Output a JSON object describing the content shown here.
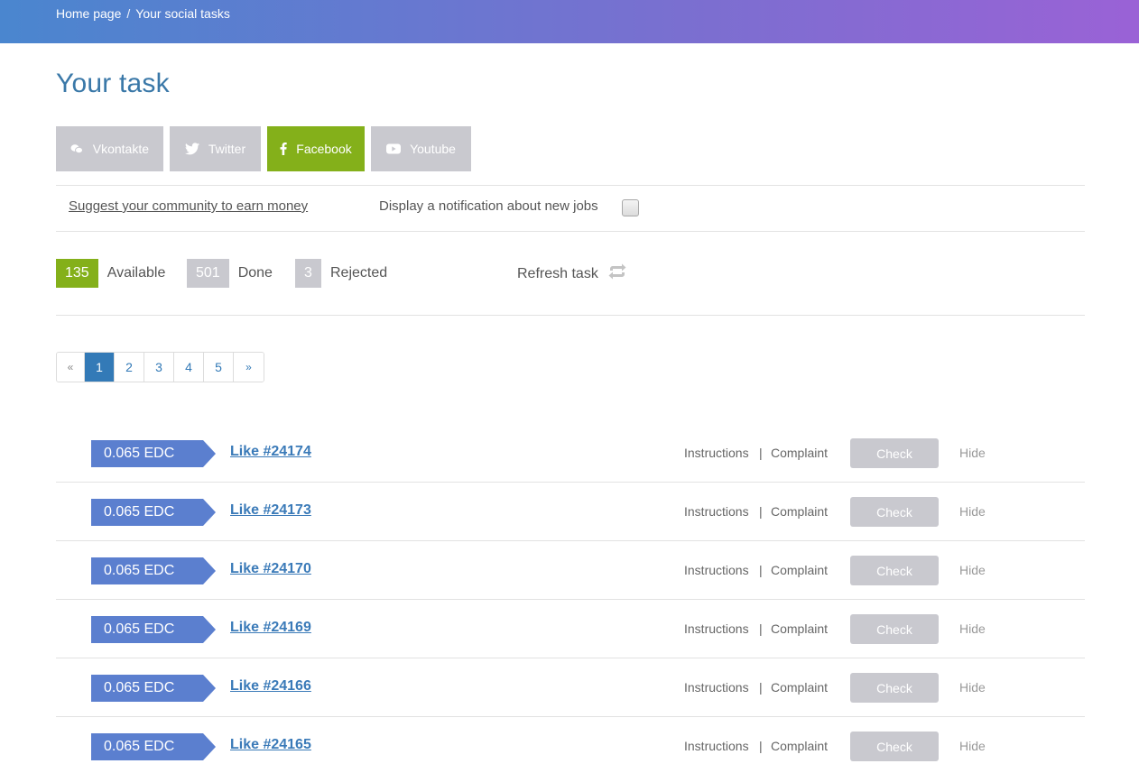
{
  "breadcrumb": {
    "home": "Home page",
    "separator": "/",
    "current": "Your social tasks"
  },
  "page_title": "Your task",
  "tabs": [
    {
      "label": "Vkontakte",
      "icon": "vk-icon",
      "active": false
    },
    {
      "label": "Twitter",
      "icon": "twitter-icon",
      "active": false
    },
    {
      "label": "Facebook",
      "icon": "facebook-icon",
      "active": true
    },
    {
      "label": "Youtube",
      "icon": "youtube-icon",
      "active": false
    }
  ],
  "options": {
    "suggest_link": "Suggest your community to earn money",
    "notify_label": "Display a notification about new jobs",
    "notify_checked": false
  },
  "stats": {
    "available": {
      "count": "135",
      "label": "Available"
    },
    "done": {
      "count": "501",
      "label": "Done"
    },
    "rejected": {
      "count": "3",
      "label": "Rejected"
    },
    "refresh_label": "Refresh task"
  },
  "pagination": {
    "prev": "«",
    "pages": [
      "1",
      "2",
      "3",
      "4",
      "5"
    ],
    "next": "»",
    "current": "1"
  },
  "task_actions": {
    "instructions": "Instructions",
    "separator": "|",
    "complaint": "Complaint",
    "check": "Check",
    "hide": "Hide"
  },
  "tasks": [
    {
      "price": "0.065 EDC",
      "title": "Like #24174"
    },
    {
      "price": "0.065 EDC",
      "title": "Like #24173"
    },
    {
      "price": "0.065 EDC",
      "title": "Like #24170"
    },
    {
      "price": "0.065 EDC",
      "title": "Like #24169"
    },
    {
      "price": "0.065 EDC",
      "title": "Like #24166"
    },
    {
      "price": "0.065 EDC",
      "title": "Like #24165"
    }
  ],
  "colors": {
    "accent_green": "#84b01a",
    "price_blue": "#5b7fcf",
    "link_blue": "#3a7ab8",
    "tab_gray": "#c9c9cf",
    "page_active": "#337ab7"
  }
}
